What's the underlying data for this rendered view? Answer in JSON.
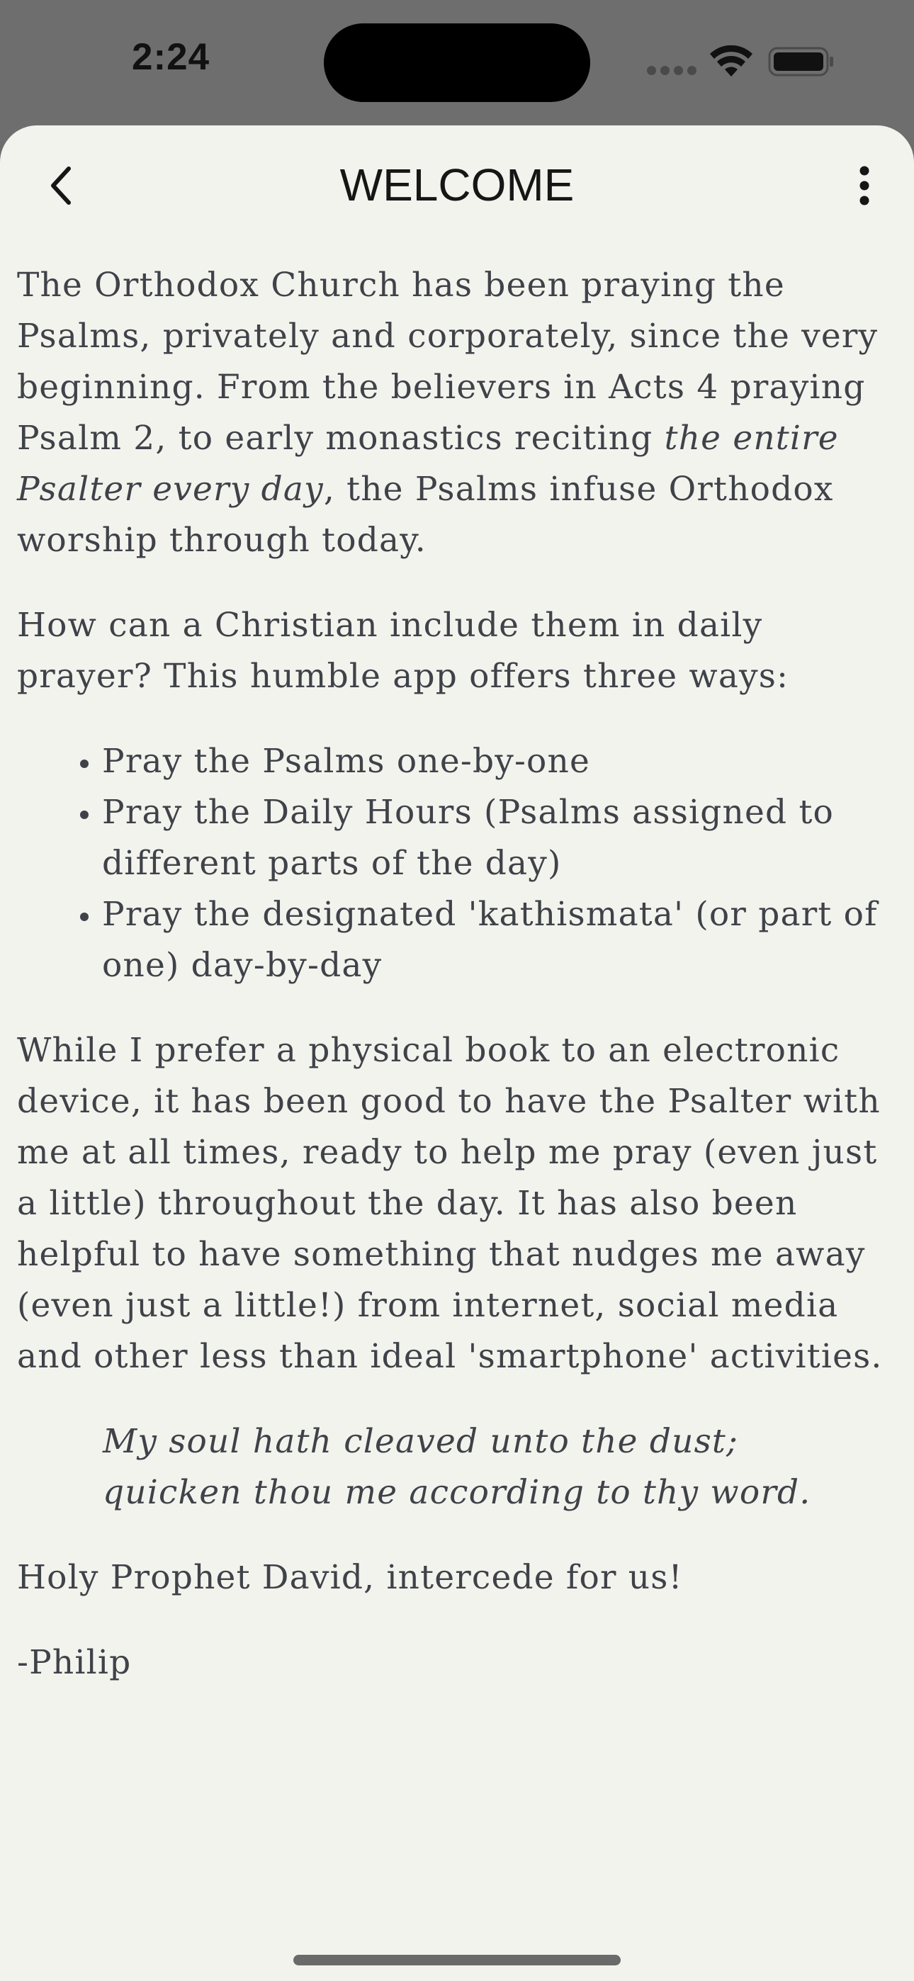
{
  "status_bar": {
    "time": "2:24"
  },
  "nav": {
    "title": "WELCOME"
  },
  "content": {
    "intro_part1": "The Orthodox Church has been praying the Psalms, privately and corporately, since the very beginning. From the believers in Acts 4 praying Psalm 2, to early monastics reciting ",
    "intro_emphasis": "the entire Psalter every day",
    "intro_part2": ", the Psalms infuse Orthodox worship through today.",
    "question": "How can a Christian include them in daily prayer? This humble app offers three ways:",
    "ways": [
      "Pray the Psalms one-by-one",
      "Pray the Daily Hours (Psalms assigned to different parts of the day)",
      "Pray the designated 'kathismata' (or part of one) day-by-day"
    ],
    "reflection": "While I prefer a physical book to an electronic device, it has been good to have the Psalter with me at all times, ready to help me pray (even just a little) throughout the day. It has also been helpful to have something that nudges me away (even just a little!) from internet, social media and other less than ideal 'smartphone' activities.",
    "quote_line1": "My soul hath cleaved unto the dust;",
    "quote_line2": "quicken thou me according to thy word.",
    "closing": "Holy Prophet David, intercede for us!",
    "signature": "-Philip"
  },
  "icons": {
    "back": "chevron-left-icon",
    "more": "more-vertical-icon",
    "signal": "cellular-signal-icon",
    "wifi": "wifi-icon",
    "battery": "battery-icon"
  }
}
